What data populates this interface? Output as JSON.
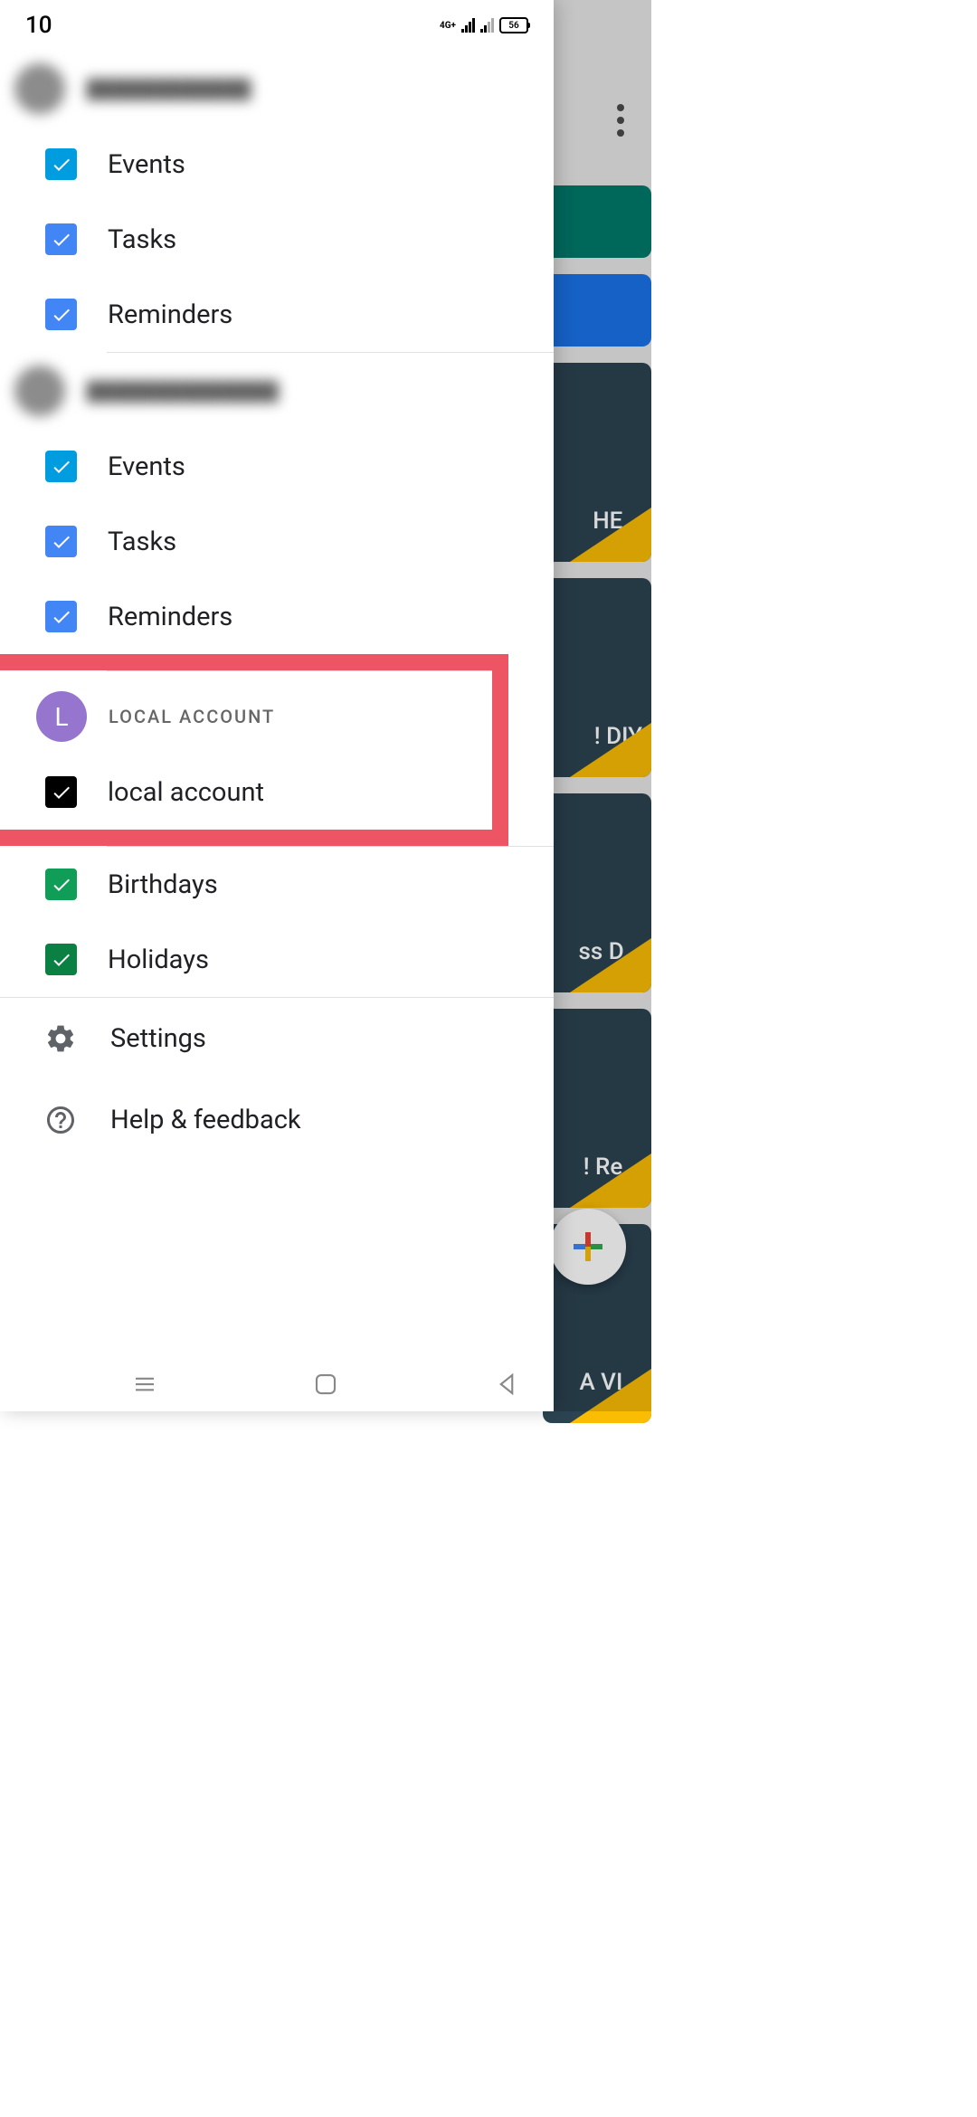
{
  "status": {
    "time": "10",
    "net": "4G+",
    "battery": "56"
  },
  "drawer": {
    "account1": {
      "items": [
        {
          "label": "Events",
          "color": "#009ce0"
        },
        {
          "label": "Tasks",
          "color": "#4285f4"
        },
        {
          "label": "Reminders",
          "color": "#4285f4"
        }
      ]
    },
    "account2": {
      "items": [
        {
          "label": "Events",
          "color": "#009ce0"
        },
        {
          "label": "Tasks",
          "color": "#4285f4"
        },
        {
          "label": "Reminders",
          "color": "#4285f4"
        }
      ]
    },
    "local": {
      "header": "LOCAL ACCOUNT",
      "avatar_letter": "L",
      "item": {
        "label": "local account",
        "color": "#000000"
      }
    },
    "general": {
      "items": [
        {
          "label": "Birthdays",
          "color": "#0f9d58"
        },
        {
          "label": "Holidays",
          "color": "#0b8043"
        }
      ]
    },
    "menu": {
      "settings": "Settings",
      "help": "Help & feedback"
    }
  },
  "background": {
    "cards": [
      {
        "text": "HE...",
        "type": "text"
      },
      {
        "text": "! DIY"
      },
      {
        "text": "ss D..."
      },
      {
        "text": "! Re..."
      },
      {
        "text": "A VI..."
      }
    ]
  }
}
